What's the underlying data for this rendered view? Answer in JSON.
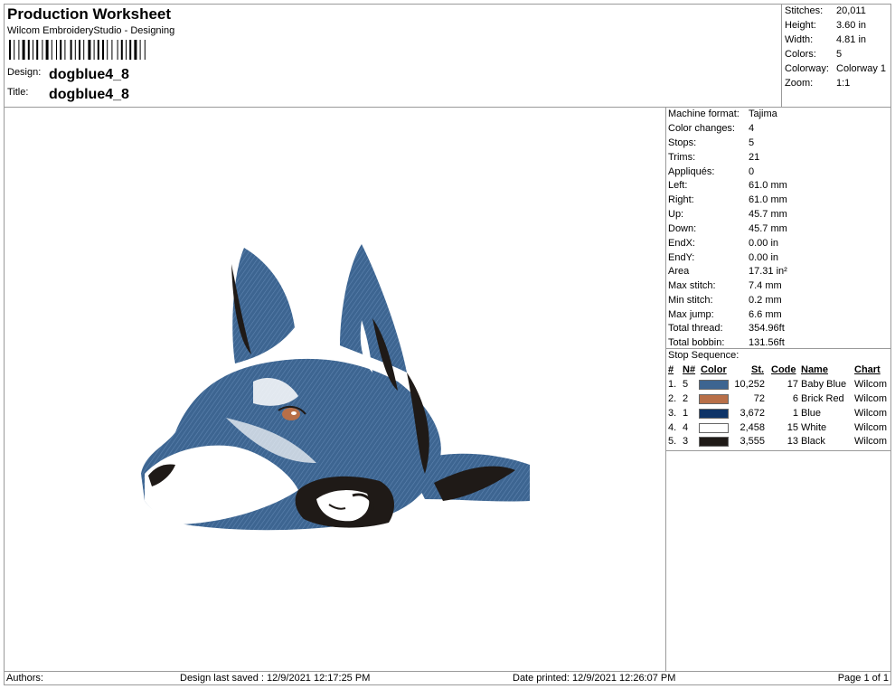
{
  "header": {
    "title": "Production Worksheet",
    "subtitle": "Wilcom EmbroideryStudio - Designing",
    "design_label": "Design:",
    "design_value": "dogblue4_8",
    "title_label": "Title:",
    "title_value": "dogblue4_8"
  },
  "summary": [
    {
      "label": "Stitches:",
      "value": "20,011"
    },
    {
      "label": "Height:",
      "value": "3.60 in"
    },
    {
      "label": "Width:",
      "value": "4.81 in"
    },
    {
      "label": "Colors:",
      "value": "5"
    },
    {
      "label": "Colorway:",
      "value": "Colorway 1"
    },
    {
      "label": "Zoom:",
      "value": "1:1"
    }
  ],
  "properties": [
    {
      "label": "Machine format:",
      "value": "Tajima"
    },
    {
      "label": "Color changes:",
      "value": "4"
    },
    {
      "label": "Stops:",
      "value": "5"
    },
    {
      "label": "Trims:",
      "value": "21"
    },
    {
      "label": "Appliqués:",
      "value": "0"
    },
    {
      "label": "Left:",
      "value": "61.0 mm"
    },
    {
      "label": "Right:",
      "value": "61.0 mm"
    },
    {
      "label": "Up:",
      "value": "45.7 mm"
    },
    {
      "label": "Down:",
      "value": "45.7 mm"
    },
    {
      "label": "EndX:",
      "value": "0.00 in"
    },
    {
      "label": "EndY:",
      "value": "0.00 in"
    },
    {
      "label": "Area",
      "value": " 17.31 in²"
    },
    {
      "label": "Max stitch:",
      "value": "7.4 mm"
    },
    {
      "label": "Min stitch:",
      "value": "0.2 mm"
    },
    {
      "label": "Max jump:",
      "value": "6.6 mm"
    },
    {
      "label": "Total thread:",
      "value": "354.96ft"
    },
    {
      "label": "Total bobbin:",
      "value": "131.56ft"
    }
  ],
  "stop_sequence": {
    "heading": "Stop Sequence:",
    "columns": [
      "#",
      "N#",
      "Color",
      "St.",
      "Code",
      "Name",
      "Chart"
    ],
    "rows": [
      {
        "num": "1.",
        "n": "5",
        "color": "#3d6591",
        "st": "10,252",
        "code": "17",
        "name": "Baby Blue",
        "chart": "Wilcom"
      },
      {
        "num": "2.",
        "n": "2",
        "color": "#b86f48",
        "st": "72",
        "code": "6",
        "name": "Brick Red",
        "chart": "Wilcom"
      },
      {
        "num": "3.",
        "n": "1",
        "color": "#0e3468",
        "st": "3,672",
        "code": "1",
        "name": "Blue",
        "chart": "Wilcom"
      },
      {
        "num": "4.",
        "n": "4",
        "color": "#ffffff",
        "st": "2,458",
        "code": "15",
        "name": "White",
        "chart": "Wilcom"
      },
      {
        "num": "5.",
        "n": "3",
        "color": "#1f1a17",
        "st": "3,555",
        "code": "13",
        "name": "Black",
        "chart": "Wilcom"
      }
    ]
  },
  "footer": {
    "authors": "Authors:",
    "last_saved": "Design last saved : 12/9/2021 12:17:25 PM",
    "printed": "Date printed: 12/9/2021 12:26:07 PM",
    "page": "Page 1 of 1"
  }
}
